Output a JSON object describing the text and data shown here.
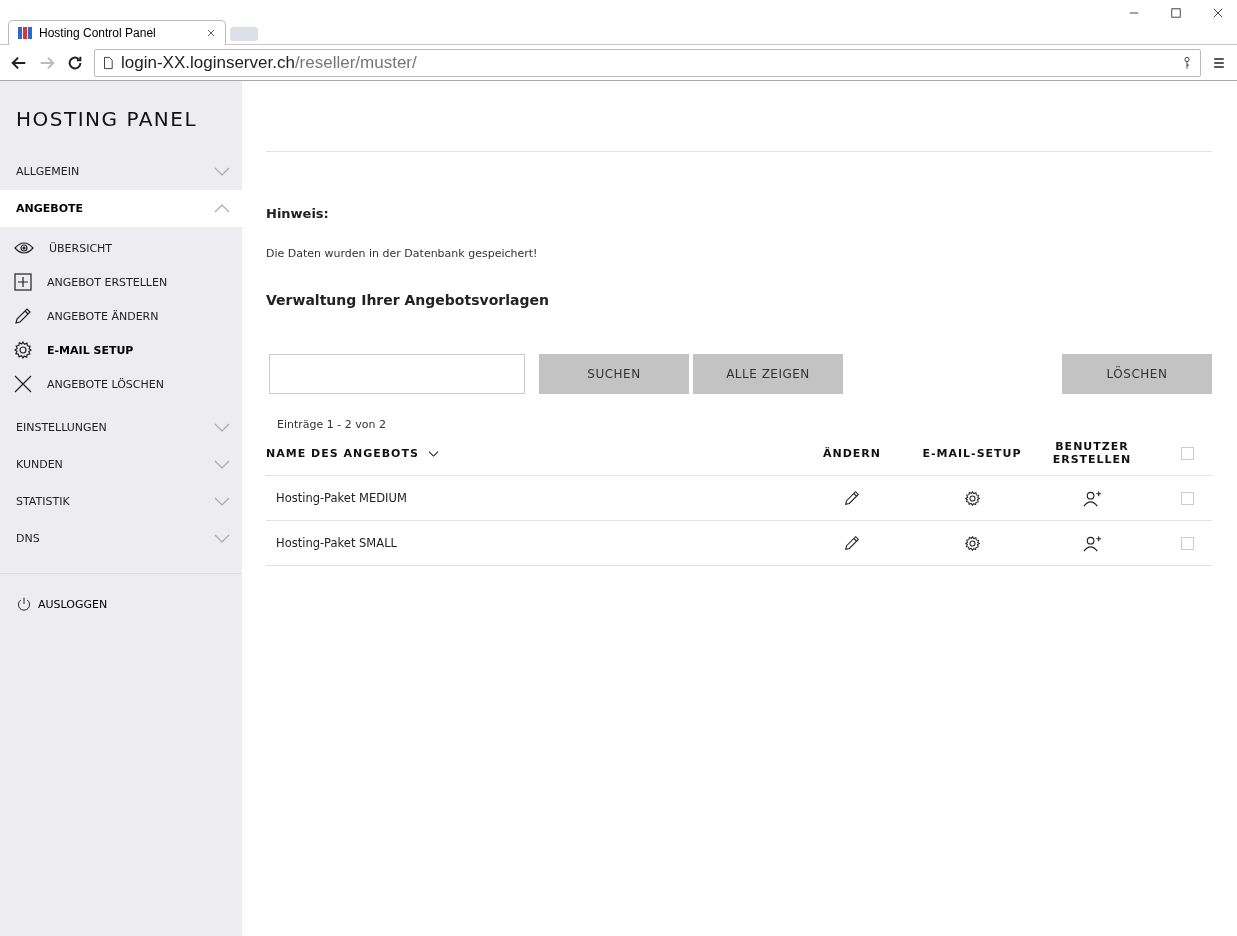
{
  "browser": {
    "tab_title": "Hosting Control Panel",
    "url_host": "login-XX.loginserver.ch",
    "url_path": "/reseller/muster/"
  },
  "sidebar": {
    "title": "HOSTING PANEL",
    "sections": [
      {
        "label": "ALLGEMEIN",
        "expanded": false
      },
      {
        "label": "ANGEBOTE",
        "expanded": true,
        "children": [
          {
            "label": "ÜBERSICHT",
            "kind": "eye",
            "selected": false
          },
          {
            "label": "ANGEBOT ERSTELLEN",
            "kind": "plus",
            "selected": false
          },
          {
            "label": "ANGEBOTE ÄNDERN",
            "kind": "pencil",
            "selected": false
          },
          {
            "label": "E-MAIL SETUP",
            "kind": "gear",
            "selected": true
          },
          {
            "label": "ANGEBOTE LÖSCHEN",
            "kind": "cross",
            "selected": false
          }
        ]
      },
      {
        "label": "EINSTELLUNGEN",
        "expanded": false
      },
      {
        "label": "KUNDEN",
        "expanded": false
      },
      {
        "label": "STATISTIK",
        "expanded": false
      },
      {
        "label": "DNS",
        "expanded": false
      }
    ],
    "logout": "AUSLOGGEN"
  },
  "notice": {
    "title": "Hinweis:",
    "message": "Die Daten wurden in der Datenbank gespeichert!"
  },
  "heading": "Verwaltung Ihrer Angebotsvorlagen",
  "toolbar": {
    "search_button": "SUCHEN",
    "show_all_button": "ALLE ZEIGEN",
    "delete_button": "LÖSCHEN"
  },
  "entries": "Einträge 1 - 2 von 2",
  "table": {
    "columns": [
      "NAME DES ANGEBOTS",
      "ÄNDERN",
      "E-MAIL-SETUP",
      "BENUTZER ERSTELLEN"
    ],
    "select_all_checked": false,
    "rows": [
      {
        "name": "Hosting-Paket MEDIUM",
        "checked": false
      },
      {
        "name": "Hosting-Paket SMALL",
        "checked": false
      }
    ]
  }
}
